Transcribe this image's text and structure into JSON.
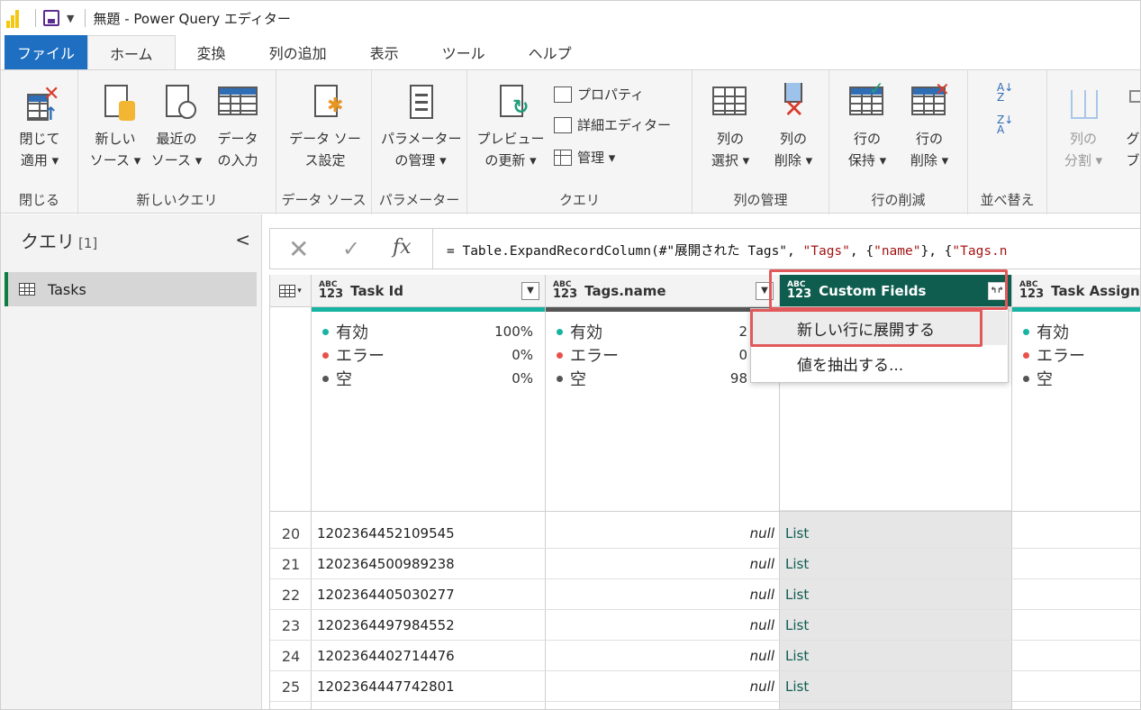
{
  "titlebar": {
    "title": "無題 - Power Query エディター"
  },
  "tabs": [
    "ファイル",
    "ホーム",
    "変換",
    "列の追加",
    "表示",
    "ツール",
    "ヘルプ"
  ],
  "ribbon": {
    "close_apply": [
      "閉じて",
      "適用 ▾"
    ],
    "close_group": "閉じる",
    "new_source": [
      "新しい",
      "ソース ▾"
    ],
    "recent_source": [
      "最近の",
      "ソース ▾"
    ],
    "enter_data": [
      "データ",
      "の入力"
    ],
    "new_query_group": "新しいクエリ",
    "ds_settings": [
      "データ ソー",
      "ス設定"
    ],
    "ds_group": "データ ソース",
    "params": [
      "パラメーター",
      "の管理 ▾"
    ],
    "params_group": "パラメーター",
    "preview": [
      "プレビュー",
      "の更新 ▾"
    ],
    "properties": "プロパティ",
    "advanced_editor": "詳細エディター",
    "manage": "管理 ▾",
    "query_group": "クエリ",
    "choose_cols": [
      "列の",
      "選択 ▾"
    ],
    "remove_cols": [
      "列の",
      "削除 ▾"
    ],
    "cols_group": "列の管理",
    "keep_rows": [
      "行の",
      "保持 ▾"
    ],
    "remove_rows": [
      "行の",
      "削除 ▾"
    ],
    "rows_group": "行の削減",
    "sort_group": "並べ替え",
    "split": [
      "列の",
      "分割 ▾"
    ],
    "group_by": [
      "グ",
      "ブ"
    ]
  },
  "left": {
    "title": "クエリ",
    "count": "[1]",
    "collapse": "<",
    "query": "Tasks"
  },
  "formula": {
    "prefix": "= Table.ExpandRecordColumn(#\"展開された Tags\", ",
    "s1": "\"Tags\"",
    "mid": ", {",
    "s2": "\"name\"",
    "mid2": "}, {",
    "s3": "\"Tags.n"
  },
  "columns": [
    {
      "name": "Task Id",
      "stats": [
        [
          "有効",
          "100%"
        ],
        [
          "エラー",
          "0%"
        ],
        [
          "空",
          "0%"
        ]
      ]
    },
    {
      "name": "Tags.name",
      "stats": [
        [
          "有効",
          "2"
        ],
        [
          "エラー",
          "0"
        ],
        [
          "空",
          "98"
        ]
      ]
    },
    {
      "name": "Custom Fields"
    },
    {
      "name": "Task Assigne",
      "stats": [
        [
          "有効",
          ""
        ],
        [
          "エラー",
          ""
        ],
        [
          "空",
          ""
        ]
      ]
    }
  ],
  "type_icon": {
    "top": "ABC",
    "bottom": "123"
  },
  "menu": {
    "expand": "新しい行に展開する",
    "extract": "値を抽出する..."
  },
  "rows": [
    {
      "n": "20",
      "id": "1202364452109545",
      "tag": "null",
      "cf": "List"
    },
    {
      "n": "21",
      "id": "1202364500989238",
      "tag": "null",
      "cf": "List"
    },
    {
      "n": "22",
      "id": "1202364405030277",
      "tag": "null",
      "cf": "List"
    },
    {
      "n": "23",
      "id": "1202364497984552",
      "tag": "null",
      "cf": "List"
    },
    {
      "n": "24",
      "id": "1202364402714476",
      "tag": "null",
      "cf": "List"
    },
    {
      "n": "25",
      "id": "1202364447742801",
      "tag": "null",
      "cf": "List"
    }
  ],
  "colors": {
    "valid": "#17b3a3",
    "error": "#e8504a",
    "empty": "#555555",
    "accent": "#0e5d4f",
    "highlight": "#e2595b"
  }
}
